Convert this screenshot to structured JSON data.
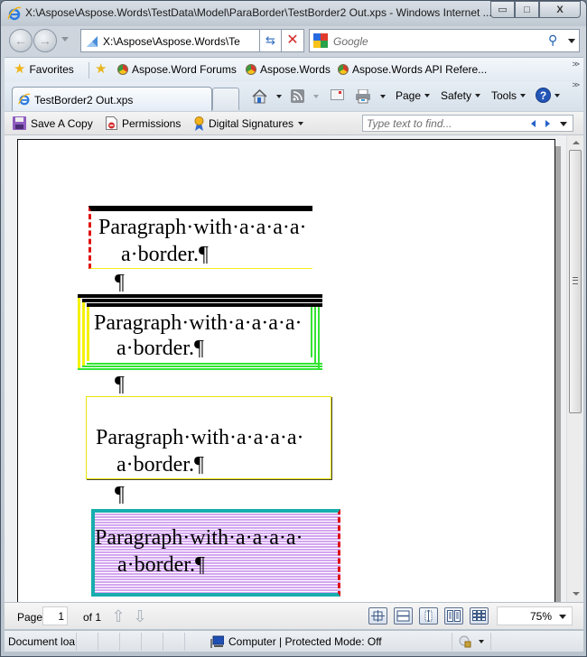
{
  "window": {
    "title": "X:\\Aspose\\Aspose.Words\\TestData\\Model\\ParaBorder\\TestBorder2 Out.xps - Windows Internet ...",
    "controls": [
      "minimize",
      "maximize",
      "close"
    ]
  },
  "nav": {
    "address": "X:\\Aspose\\Aspose.Words\\Te",
    "search_placeholder": "Google"
  },
  "favorites": {
    "label": "Favorites",
    "items": [
      {
        "label": "Aspose.Word Forums"
      },
      {
        "label": "Aspose.Words"
      },
      {
        "label": "Aspose.Words API Refere..."
      }
    ]
  },
  "tabs": {
    "active": "TestBorder2 Out.xps",
    "commands": {
      "page": "Page",
      "safety": "Safety",
      "tools": "Tools"
    }
  },
  "xps_toolbar": {
    "save_copy": "Save A Copy",
    "permissions": "Permissions",
    "signatures": "Digital Signatures",
    "find_placeholder": "Type text to find..."
  },
  "document": {
    "paragraphs": [
      {
        "line1": "Paragraph·with·a·a·a·a·",
        "line2": "a·border.¶",
        "border": "top black thick, left red dashed, bottom yellow"
      },
      {
        "line1": "Paragraph·with·a·a·a·a·",
        "line2": "a·border.¶",
        "border": "triple black top, triple yellow left, triple green right/bottom"
      },
      {
        "line1": "Paragraph·with·a·a·a·a·",
        "line2": "a·border.¶",
        "border": "thin yellow box with shadow"
      },
      {
        "line1": "Paragraph·with·a·a·a·a·",
        "line2": "a·border.¶",
        "border": "teal box, red dashed right, violet striped shading"
      }
    ],
    "empty_para_mark": "¶"
  },
  "pagebar": {
    "page_label": "Page",
    "page_value": "1",
    "of_label": "of 1",
    "zoom": "75%"
  },
  "status": {
    "text": "Document loa",
    "zone": "Computer | Protected Mode: Off"
  },
  "colors": {
    "border_black": "#000000",
    "border_red": "#e01010",
    "border_yellow": "#f5f20c",
    "border_green": "#33e433",
    "border_teal": "#16aeae",
    "shading_violet": "#d4a6f0"
  }
}
